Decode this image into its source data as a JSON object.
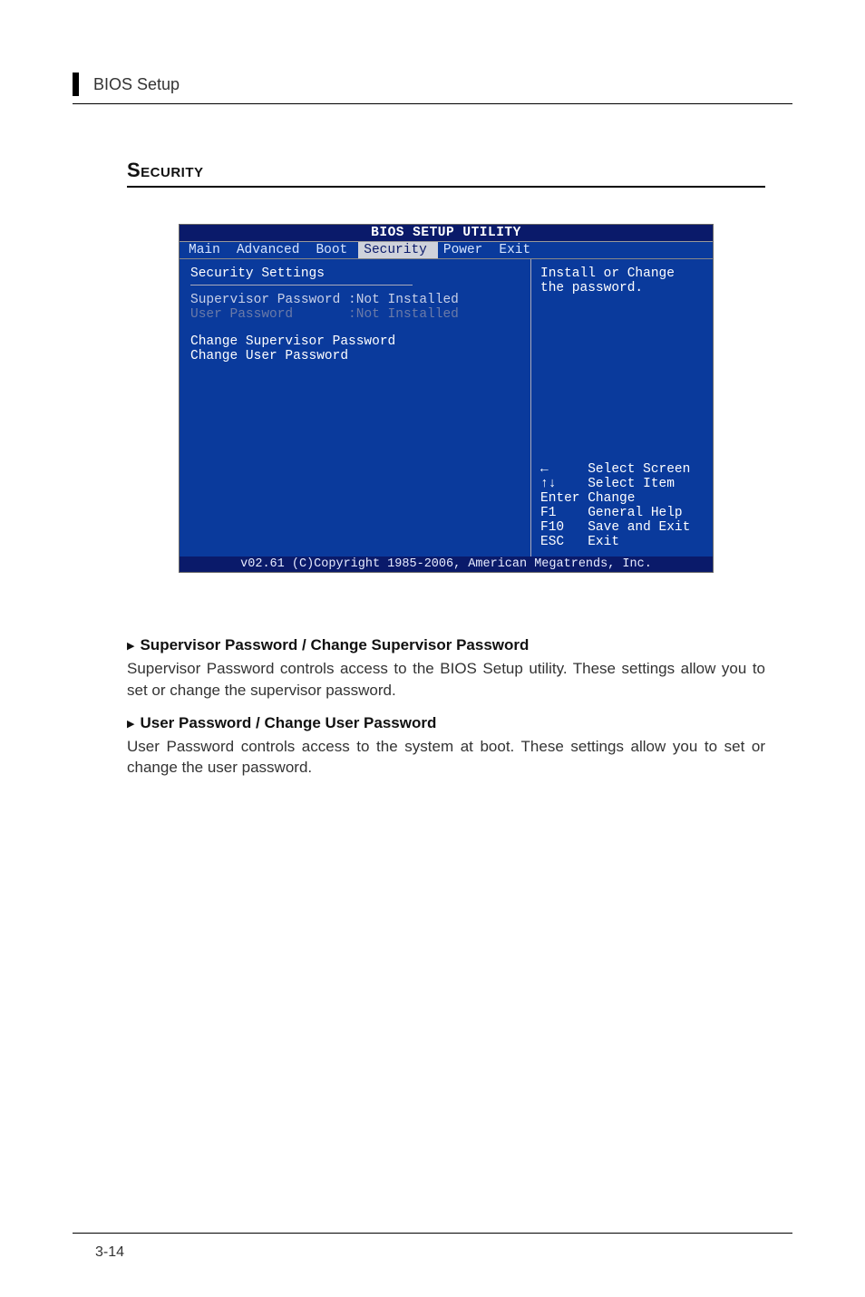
{
  "page": {
    "header": "BIOS Setup",
    "section_title": "Security",
    "page_number": "3-14"
  },
  "bios": {
    "title": "BIOS SETUP UTILITY",
    "menu": [
      "Main",
      "Advanced",
      "Boot",
      "Security",
      "Power",
      "Exit"
    ],
    "menu_selected_index": 3,
    "left": {
      "heading": "Security Settings",
      "supervisor_label": "Supervisor Password",
      "supervisor_value": ":Not Installed",
      "user_label": "User Password",
      "user_value": ":Not Installed",
      "change_supervisor": "Change Supervisor Password",
      "change_user": "Change User Password"
    },
    "right": {
      "help": "Install or Change the password.",
      "keys": [
        {
          "key": "←",
          "label": "Select Screen"
        },
        {
          "key": "↑↓",
          "label": "Select Item"
        },
        {
          "key": "Enter",
          "label": "Change"
        },
        {
          "key": "F1",
          "label": "General Help"
        },
        {
          "key": "F10",
          "label": "Save and Exit"
        },
        {
          "key": "ESC",
          "label": "Exit"
        }
      ]
    },
    "footer": "v02.61 (C)Copyright 1985-2006, American Megatrends, Inc."
  },
  "items": [
    {
      "head": "Supervisor Password / Change Supervisor Password",
      "body": "Supervisor Password controls access to the BIOS Setup utility. These settings allow you to set or change the supervisor password."
    },
    {
      "head": "User Password / Change User Password",
      "body": "User Password controls access to the system at boot. These settings allow you to set or change the user password."
    }
  ]
}
